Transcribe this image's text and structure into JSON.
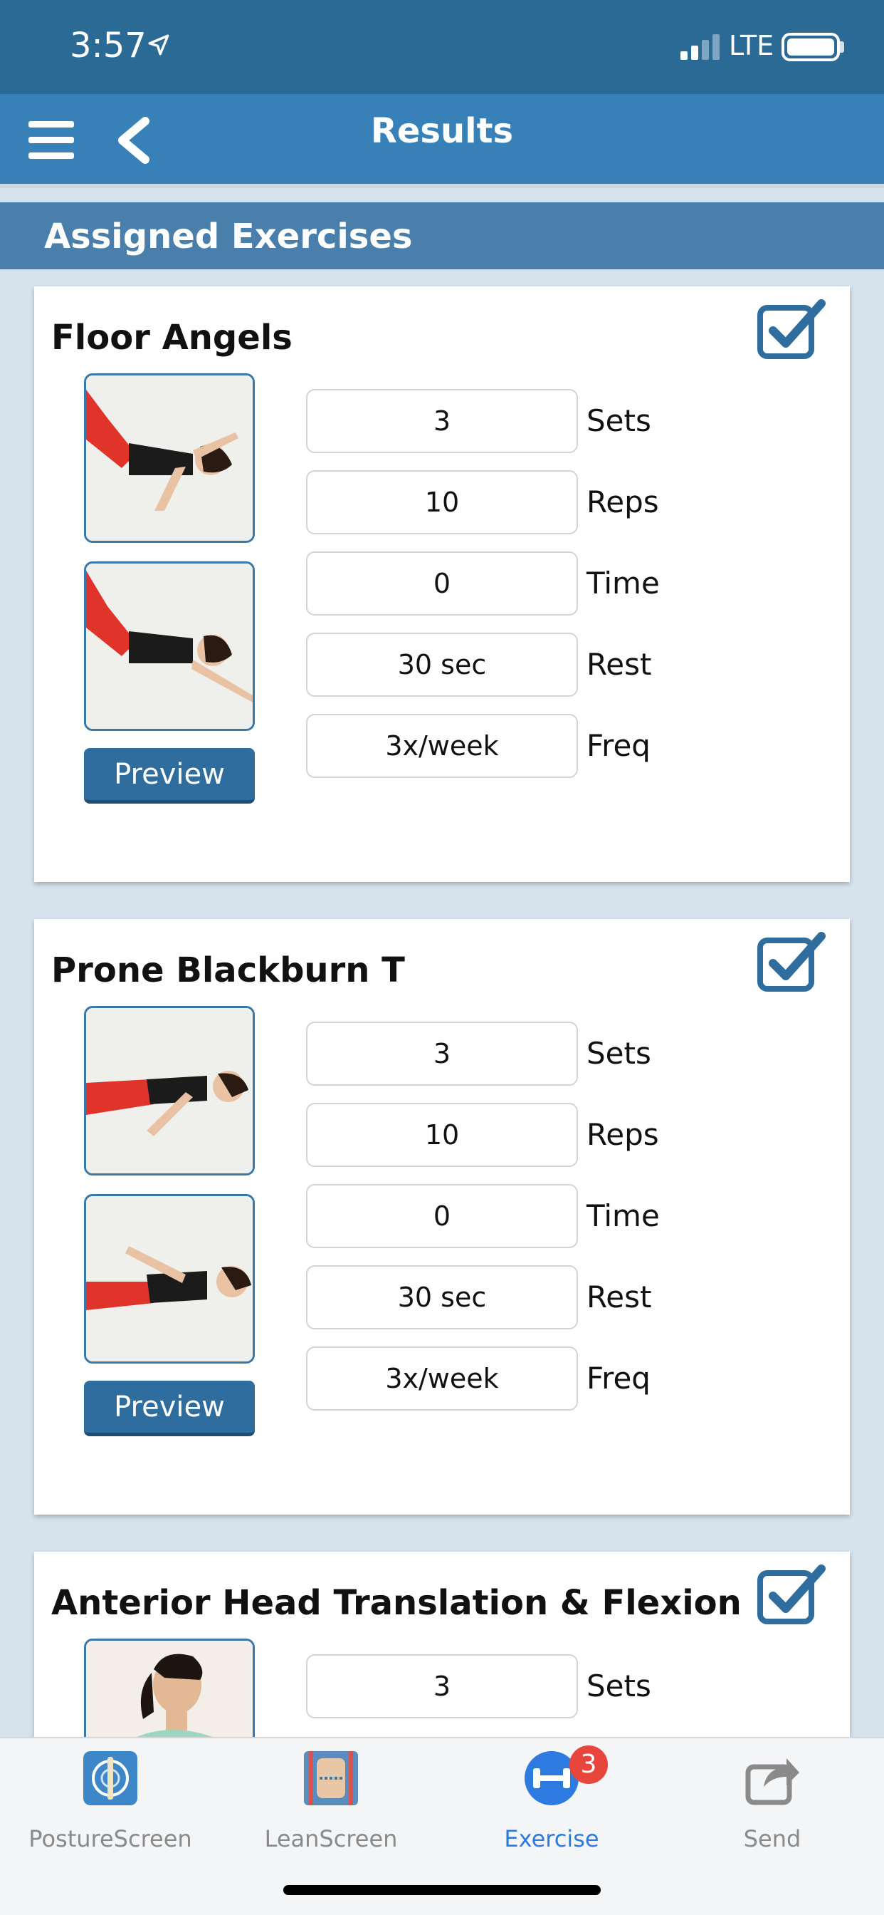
{
  "status_bar": {
    "time": "3:57",
    "network": "LTE"
  },
  "nav": {
    "title": "Results"
  },
  "section": {
    "title": "Assigned Exercises"
  },
  "exercises": [
    {
      "name": "Floor Angels",
      "checked": true,
      "preview_label": "Preview",
      "fields": [
        {
          "value": "3",
          "label": "Sets"
        },
        {
          "value": "10",
          "label": "Reps"
        },
        {
          "value": "0",
          "label": "Time"
        },
        {
          "value": "30 sec",
          "label": "Rest"
        },
        {
          "value": "3x/week",
          "label": "Freq"
        }
      ]
    },
    {
      "name": "Prone Blackburn T",
      "checked": true,
      "preview_label": "Preview",
      "fields": [
        {
          "value": "3",
          "label": "Sets"
        },
        {
          "value": "10",
          "label": "Reps"
        },
        {
          "value": "0",
          "label": "Time"
        },
        {
          "value": "30 sec",
          "label": "Rest"
        },
        {
          "value": "3x/week",
          "label": "Freq"
        }
      ]
    },
    {
      "name": "Anterior Head Translation & Flexion",
      "checked": true,
      "fields": [
        {
          "value": "3",
          "label": "Sets"
        }
      ]
    }
  ],
  "tabs": [
    {
      "label": "PostureScreen",
      "icon": "spine-target-icon",
      "active": false
    },
    {
      "label": "LeanScreen",
      "icon": "body-scan-icon",
      "active": false
    },
    {
      "label": "Exercise",
      "icon": "dumbbell-icon",
      "active": true,
      "badge": "3"
    },
    {
      "label": "Send",
      "icon": "share-arrow-icon",
      "active": false
    }
  ],
  "colors": {
    "status_bar": "#2c6a96",
    "nav_bar": "#3781b8",
    "section_header": "#4a7fab",
    "preview_button": "#2f6d9e",
    "active_tab": "#2d7be0",
    "badge": "#e8453c"
  }
}
